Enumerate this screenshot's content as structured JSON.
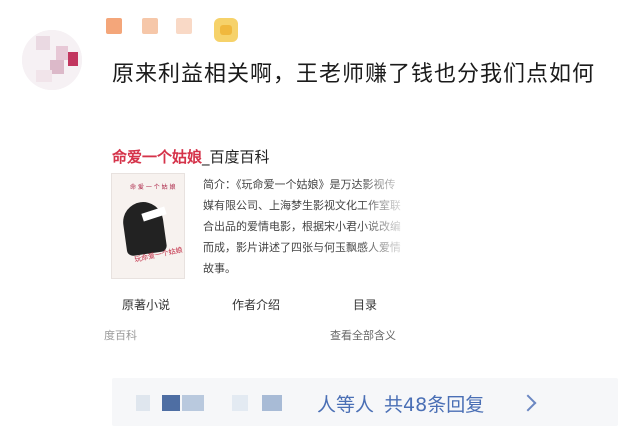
{
  "comment": {
    "text": "原来利益相关啊，王老师赚了钱也分我们点如何"
  },
  "baike_card": {
    "title_main": "命爱一个姑娘",
    "title_suffix": "_百度百科",
    "cover_title": "命 爱 一 个 姑 娘",
    "cover_script": "玩命爱一个姑娘",
    "description": "简介：《玩命爱一个姑娘》是万达影视传媒有限公司、上海梦生影视文化工作室联合出品的爱情电影，根据宋小君小说改编而成，影片讲述了四张与何玉飘感人爱情故事。",
    "tabs": [
      "原著小说",
      "作者介绍",
      "目录"
    ],
    "source": "度百科",
    "more_label": "查看全部含义"
  },
  "replies": {
    "names_suffix": "人等人",
    "count_label": "共48条回复",
    "chevron": "chevron-right-icon"
  },
  "colors": {
    "accent_red": "#d5334a",
    "link_blue": "#4a6fb5",
    "reply_bg": "#f6f7f9"
  }
}
